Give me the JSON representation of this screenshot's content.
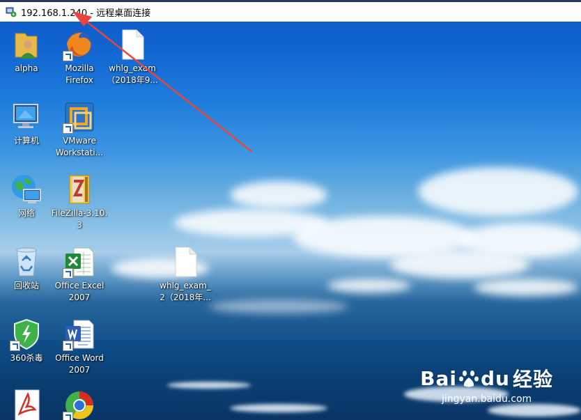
{
  "window": {
    "title": "192.168.1.240 - 远程桌面连接",
    "icon": "remote-desktop-icon"
  },
  "desktop": {
    "icons": [
      {
        "name": "alpha",
        "label_lines": [
          "alpha"
        ],
        "icon": "user-folder-icon",
        "shortcut": false
      },
      {
        "name": "mozilla-firefox",
        "label_lines": [
          "Mozilla",
          "Firefox"
        ],
        "icon": "firefox-icon",
        "shortcut": true
      },
      {
        "name": "whlg-exam-file-1",
        "label_lines": [
          "whlg_exam",
          "（2018年9..."
        ],
        "icon": "blank-file-icon",
        "shortcut": false
      },
      {
        "name": "computer",
        "label_lines": [
          "计算机"
        ],
        "icon": "computer-icon",
        "shortcut": false
      },
      {
        "name": "vmware-workstation",
        "label_lines": [
          "VMware",
          "Workstati..."
        ],
        "icon": "vmware-icon",
        "shortcut": true
      },
      {
        "name": "network",
        "label_lines": [
          "网络"
        ],
        "icon": "network-globe-icon",
        "shortcut": false
      },
      {
        "name": "filezilla",
        "label_lines": [
          "FileZilla-3.10.",
          "3"
        ],
        "icon": "zip-folder-icon",
        "shortcut": false
      },
      {
        "name": "recycle-bin",
        "label_lines": [
          "回收站"
        ],
        "icon": "recycle-bin-icon",
        "shortcut": false
      },
      {
        "name": "office-excel-2007",
        "label_lines": [
          "Office Excel",
          "2007"
        ],
        "icon": "excel-icon",
        "shortcut": true
      },
      {
        "name": "whlg-exam-file-2",
        "label_lines": [
          "whlg_exam_",
          "2（2018年..."
        ],
        "icon": "blank-file-icon",
        "shortcut": false
      },
      {
        "name": "360-antivirus",
        "label_lines": [
          "360杀毒"
        ],
        "icon": "shield-icon",
        "shortcut": true
      },
      {
        "name": "office-word-2007",
        "label_lines": [
          "Office Word",
          "2007"
        ],
        "icon": "word-icon",
        "shortcut": true
      },
      {
        "name": "acrobat-reader",
        "label_lines": [],
        "icon": "pdf-icon",
        "shortcut": false
      },
      {
        "name": "browser-360",
        "label_lines": [],
        "icon": "browser-icon",
        "shortcut": true
      }
    ]
  },
  "annotation": {
    "arrow_color": "#e8453c"
  },
  "watermark": {
    "brand_left": "Bai",
    "brand_mid": "du",
    "brand_right": "经验",
    "url": "jingyan.baidu.com"
  },
  "colors": {
    "title_bg": "#ffffff",
    "label_text": "#ffffff"
  }
}
